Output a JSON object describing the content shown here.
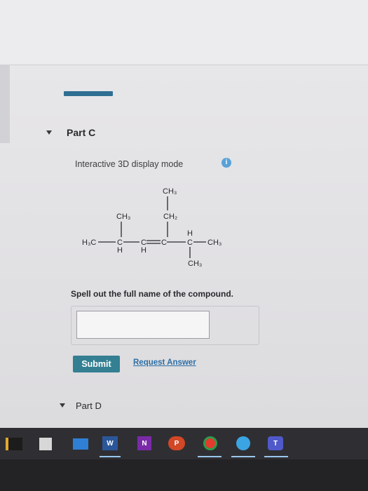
{
  "part_c": {
    "title": "Part C",
    "display_mode_label": "Interactive 3D display mode",
    "info_icon_glyph": "i"
  },
  "structure": {
    "ch3_top": "CH3",
    "ch3_left": "CH3",
    "ch2": "CH2",
    "h3c": "H3C",
    "c1": "C",
    "c2": "C",
    "c3": "C",
    "c4": "C",
    "h_c1": "H",
    "h_c2": "H",
    "h_c4": "H",
    "ch3_right": "CH3",
    "ch3_bottom": "CH3"
  },
  "question": {
    "prompt": "Spell out the full name of the compound.",
    "answer_value": "",
    "submit_label": "Submit",
    "request_answer_label": "Request Answer"
  },
  "part_d": {
    "title": "Part D"
  },
  "taskbar": {
    "word_letter": "W",
    "onenote_letter": "N",
    "powerpoint_letter": "P",
    "teams_letter": "T"
  },
  "colors": {
    "accent": "#2f6f92",
    "submit": "#347f92",
    "link": "#2d6fa5",
    "info": "#5aa2d8"
  }
}
